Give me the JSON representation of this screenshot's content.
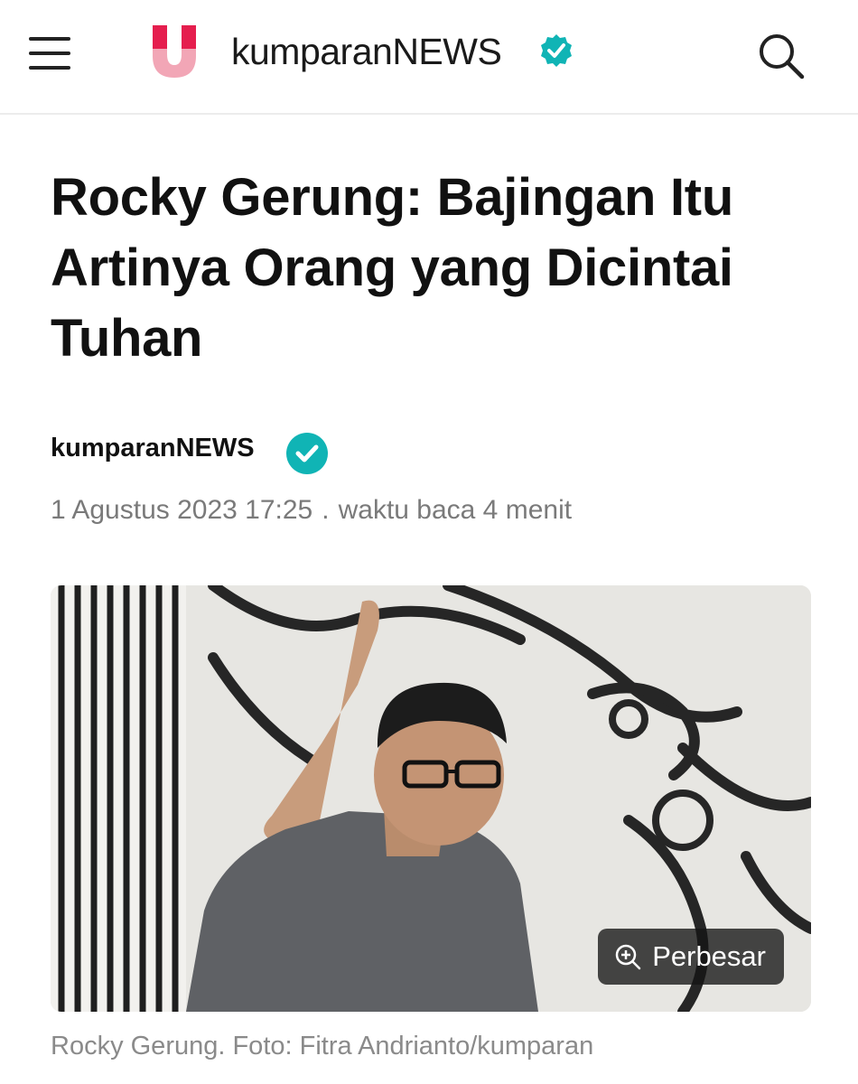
{
  "header": {
    "brand": "kumparanNEWS",
    "menu_icon": "hamburger-menu-icon",
    "search_icon": "search-icon",
    "logo_icon": "kumparan-logo-icon",
    "verified_icon": "verified-check-icon",
    "brand_color": "#e51e4e",
    "verified_color": "#10b4b5"
  },
  "article": {
    "title": "Rocky Gerung: Bajingan Itu Artinya Orang yang Dicintai Tuhan",
    "author": "kumparanNEWS",
    "date": "1 Agustus 2023 17:25",
    "separator": ".",
    "read_time": "waktu baca 4 menit",
    "zoom_label": "Perbesar",
    "caption": "Rocky Gerung. Foto: Fitra Andrianto/kumparan"
  }
}
